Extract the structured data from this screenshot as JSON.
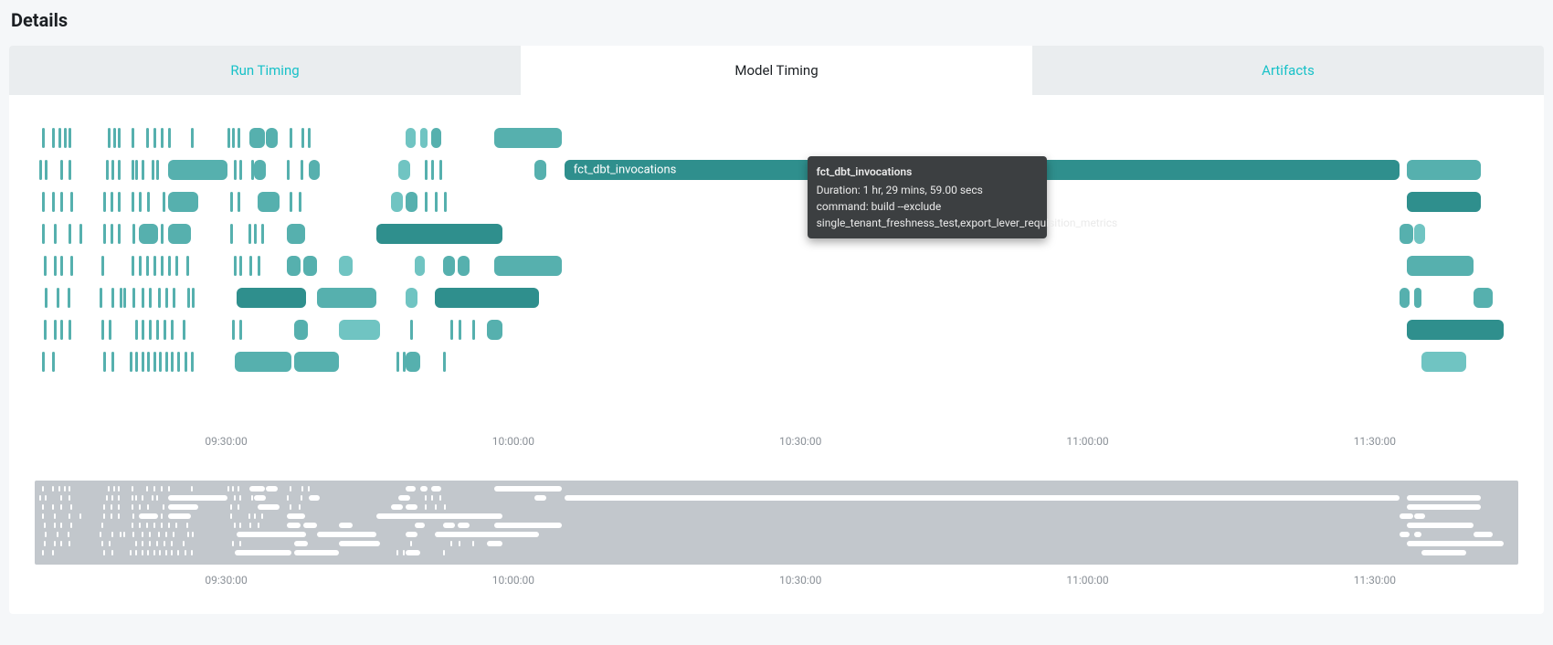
{
  "header": {
    "title": "Details"
  },
  "tabs": [
    {
      "id": "run-timing",
      "label": "Run Timing",
      "active": false
    },
    {
      "id": "model-timing",
      "label": "Model Timing",
      "active": true
    },
    {
      "id": "artifacts",
      "label": "Artifacts",
      "active": false
    }
  ],
  "tooltip": {
    "title": "fct_dbt_invocations",
    "duration_label": "Duration: 1 hr, 29 mins, 59.00 secs",
    "command_label": "command: build --exclude",
    "exclude_label": "single_tenant_freshness_test,export_lever_requisition_metrics"
  },
  "selected_bar_label": "fct_dbt_invocations",
  "axis": {
    "ticks": [
      "09:30:00",
      "10:00:00",
      "10:30:00",
      "11:00:00",
      "11:30:00"
    ]
  },
  "chart_data": {
    "type": "gantt",
    "x_unit": "time",
    "x_domain_start": "09:10:00",
    "x_domain_end": "11:45:00",
    "axis_ticks": [
      "09:30:00",
      "10:00:00",
      "10:30:00",
      "11:00:00",
      "11:30:00"
    ],
    "row_count": 8,
    "colors": {
      "l": "#70c4c2",
      "m": "#56b0ae",
      "d": "#2f8f8d"
    },
    "selected": {
      "row": 1,
      "name": "fct_dbt_invocations",
      "start": "09:58:00",
      "end": "11:28:00",
      "duration": "1 hr, 29 mins, 59.00 secs",
      "command": "build --exclude",
      "exclude": "single_tenant_freshness_test,export_lever_requisition_metrics",
      "color": "d"
    },
    "rows": [
      {
        "row": 0,
        "ticks_pct": [
          0.5,
          1.2,
          1.6,
          2.0,
          2.3,
          4.9,
          5.3,
          5.6,
          6.5,
          7.5,
          8.0,
          8.5,
          9.0,
          10.5,
          13.0,
          13.3,
          13.7,
          17.2,
          18.0,
          18.4
        ],
        "ticks_color": "m",
        "bars": [
          {
            "s": 14.5,
            "e": 15.5,
            "c": "m"
          },
          {
            "s": 15.6,
            "e": 16.4,
            "c": "m"
          },
          {
            "s": 25.0,
            "e": 25.7,
            "c": "l"
          },
          {
            "s": 26.0,
            "e": 26.5,
            "c": "l"
          },
          {
            "s": 26.7,
            "e": 27.4,
            "c": "m"
          },
          {
            "s": 31.0,
            "e": 35.5,
            "c": "m"
          }
        ]
      },
      {
        "row": 1,
        "ticks_pct": [
          0.3,
          0.7,
          1.7,
          2.3,
          4.8,
          5.2,
          5.6,
          6.5,
          6.8,
          7.2,
          7.9,
          8.2,
          13.4,
          13.8,
          14.6,
          17.0,
          17.9,
          26.3,
          26.7,
          27.3
        ],
        "ticks_color": "m",
        "bars": [
          {
            "s": 9.0,
            "e": 13.0,
            "c": "m"
          },
          {
            "s": 14.8,
            "e": 15.6,
            "c": "m"
          },
          {
            "s": 18.5,
            "e": 19.2,
            "c": "m"
          },
          {
            "s": 24.5,
            "e": 25.3,
            "c": "l"
          },
          {
            "s": 33.7,
            "e": 34.5,
            "c": "m"
          },
          {
            "s": 35.7,
            "e": 92.0,
            "c": "d",
            "label": "fct_dbt_invocations"
          },
          {
            "s": 92.5,
            "e": 97.5,
            "c": "m"
          }
        ]
      },
      {
        "row": 2,
        "ticks_pct": [
          0.5,
          1.2,
          1.7,
          2.4,
          4.6,
          5.1,
          5.6,
          6.5,
          7.0,
          7.6,
          8.6,
          13.2,
          13.7,
          17.2,
          17.8,
          26.3,
          27.0,
          27.6
        ],
        "ticks_color": "m",
        "bars": [
          {
            "s": 9.0,
            "e": 11.0,
            "c": "m"
          },
          {
            "s": 15.0,
            "e": 16.5,
            "c": "m"
          },
          {
            "s": 24.0,
            "e": 24.8,
            "c": "l"
          },
          {
            "s": 25.0,
            "e": 25.8,
            "c": "m"
          },
          {
            "s": 92.5,
            "e": 97.5,
            "c": "d"
          }
        ]
      },
      {
        "row": 3,
        "ticks_pct": [
          0.5,
          1.3,
          2.3,
          3.0,
          4.6,
          5.1,
          5.6,
          6.6,
          8.5,
          13.2,
          14.4,
          14.8,
          15.3
        ],
        "ticks_color": "m",
        "bars": [
          {
            "s": 7.0,
            "e": 8.3,
            "c": "m"
          },
          {
            "s": 9.0,
            "e": 10.5,
            "c": "m"
          },
          {
            "s": 17.0,
            "e": 18.2,
            "c": "m"
          },
          {
            "s": 23.0,
            "e": 31.5,
            "c": "d"
          },
          {
            "s": 92.0,
            "e": 92.9,
            "c": "m"
          },
          {
            "s": 93.0,
            "e": 93.7,
            "c": "l"
          }
        ]
      },
      {
        "row": 4,
        "ticks_pct": [
          0.6,
          1.3,
          1.7,
          2.4,
          4.5,
          6.5,
          7.0,
          7.5,
          8.0,
          8.5,
          9.0,
          9.5,
          10.2,
          13.4,
          13.8,
          14.5,
          15.0
        ],
        "ticks_color": "m",
        "bars": [
          {
            "s": 17.0,
            "e": 17.9,
            "c": "m"
          },
          {
            "s": 18.1,
            "e": 19.0,
            "c": "m"
          },
          {
            "s": 20.5,
            "e": 21.4,
            "c": "l"
          },
          {
            "s": 25.6,
            "e": 26.3,
            "c": "l"
          },
          {
            "s": 27.5,
            "e": 28.3,
            "c": "m"
          },
          {
            "s": 28.5,
            "e": 29.3,
            "c": "m"
          },
          {
            "s": 31.0,
            "e": 35.5,
            "c": "m"
          },
          {
            "s": 92.5,
            "e": 97.0,
            "c": "m"
          }
        ]
      },
      {
        "row": 5,
        "ticks_pct": [
          0.7,
          1.5,
          2.2,
          4.4,
          5.2,
          5.7,
          6.0,
          6.6,
          7.2,
          7.7,
          8.3,
          8.8,
          9.3,
          10.3,
          10.6
        ],
        "ticks_color": "m",
        "bars": [
          {
            "s": 13.6,
            "e": 18.3,
            "c": "d"
          },
          {
            "s": 19.0,
            "e": 23.0,
            "c": "m"
          },
          {
            "s": 25.0,
            "e": 25.8,
            "c": "l"
          },
          {
            "s": 27.0,
            "e": 34.0,
            "c": "d"
          },
          {
            "s": 92.0,
            "e": 92.7,
            "c": "m"
          },
          {
            "s": 93.0,
            "e": 93.5,
            "c": "m"
          },
          {
            "s": 97.0,
            "e": 98.3,
            "c": "m"
          }
        ]
      },
      {
        "row": 6,
        "ticks_pct": [
          0.6,
          1.3,
          1.7,
          2.3,
          4.5,
          5.0,
          6.8,
          7.2,
          7.7,
          8.2,
          8.7,
          9.2,
          10.0,
          13.3,
          13.8,
          25.3,
          28.0,
          28.6,
          29.5
        ],
        "ticks_color": "m",
        "bars": [
          {
            "s": 17.5,
            "e": 18.4,
            "c": "m"
          },
          {
            "s": 20.5,
            "e": 23.3,
            "c": "l"
          },
          {
            "s": 30.5,
            "e": 31.5,
            "c": "m"
          },
          {
            "s": 92.5,
            "e": 99.0,
            "c": "d"
          }
        ]
      },
      {
        "row": 7,
        "ticks_pct": [
          0.5,
          1.2,
          4.6,
          5.2,
          6.4,
          6.8,
          7.2,
          7.6,
          8.0,
          8.4,
          8.8,
          9.2,
          9.6,
          10.1,
          10.5,
          24.4,
          24.8,
          27.5
        ],
        "ticks_color": "m",
        "bars": [
          {
            "s": 13.5,
            "e": 17.3,
            "c": "m"
          },
          {
            "s": 17.5,
            "e": 20.5,
            "c": "m"
          },
          {
            "s": 25.0,
            "e": 26.0,
            "c": "m"
          },
          {
            "s": 93.5,
            "e": 96.5,
            "c": "l"
          }
        ]
      }
    ]
  }
}
